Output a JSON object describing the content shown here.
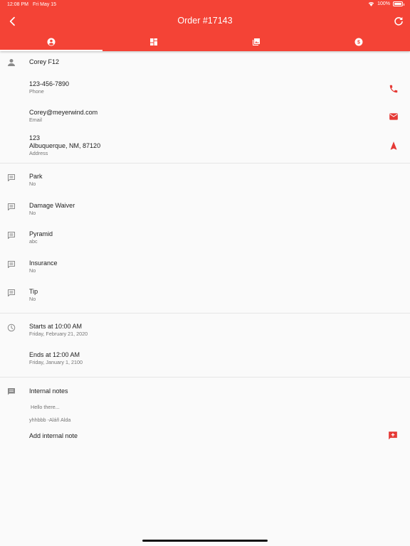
{
  "status_bar": {
    "time": "12:08 PM",
    "date": "Fri May 15",
    "battery": "100%"
  },
  "header": {
    "title": "Order #17143",
    "back_icon": "chevron-left-icon",
    "refresh_icon": "refresh-icon"
  },
  "tabs": [
    {
      "icon": "person-circle-icon",
      "active": true
    },
    {
      "icon": "dashboard-icon",
      "active": false
    },
    {
      "icon": "photo-library-icon",
      "active": false
    },
    {
      "icon": "dollar-circle-icon",
      "active": false
    }
  ],
  "customer": {
    "name": "Corey F12",
    "phone": {
      "value": "123-456-7890",
      "label": "Phone"
    },
    "email": {
      "value": "Corey@meyerwind.com",
      "label": "Email"
    },
    "address": {
      "line1": "123",
      "line2": "Albuquerque, NM, 87120",
      "label": "Address"
    }
  },
  "fields": [
    {
      "title": "Park",
      "value": "No"
    },
    {
      "title": "Damage Waiver",
      "value": "No"
    },
    {
      "title": "Pyramid",
      "value": "abc"
    },
    {
      "title": "Insurance",
      "value": "No"
    },
    {
      "title": "Tip",
      "value": "No"
    }
  ],
  "schedule": {
    "start": {
      "title": "Starts at 10:00 AM",
      "date": "Friday, February 21, 2020"
    },
    "end": {
      "title": "Ends at 12:00 AM",
      "date": "Friday, January 1, 2100"
    }
  },
  "notes": {
    "title": "Internal notes",
    "placeholder": "Hello there...",
    "entry": "yhhbbb -Aláñ Alda",
    "add_label": "Add internal note"
  },
  "colors": {
    "primary": "#f44336",
    "accent": "#e53935"
  }
}
